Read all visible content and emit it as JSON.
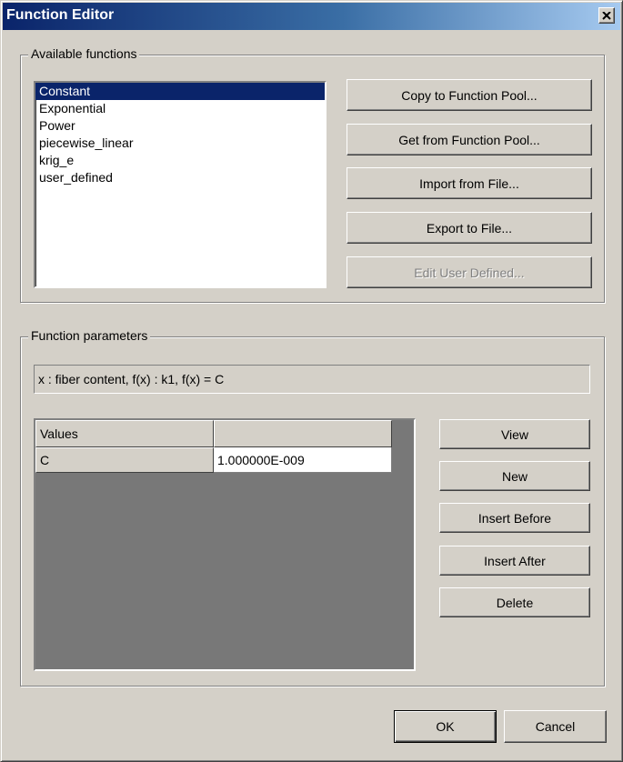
{
  "window": {
    "title": "Function Editor"
  },
  "available": {
    "group_label": "Available functions",
    "items": [
      "Constant",
      "Exponential",
      "Power",
      "piecewise_linear",
      "krig_e",
      "user_defined"
    ],
    "selected_index": 0,
    "buttons": {
      "copy": "Copy to Function Pool...",
      "get": "Get from Function Pool...",
      "import": "Import from File...",
      "export": "Export to File...",
      "edit_user": "Edit User Defined..."
    }
  },
  "params": {
    "group_label": "Function parameters",
    "description": "x : fiber content,   f(x) : k1,   f(x) = C",
    "table": {
      "headers": [
        "Values",
        ""
      ],
      "rows": [
        [
          "C",
          "1.000000E-009"
        ]
      ]
    },
    "buttons": {
      "view": "View",
      "new": "New",
      "insert_before": "Insert Before",
      "insert_after": "Insert After",
      "delete": "Delete"
    }
  },
  "footer": {
    "ok": "OK",
    "cancel": "Cancel"
  }
}
